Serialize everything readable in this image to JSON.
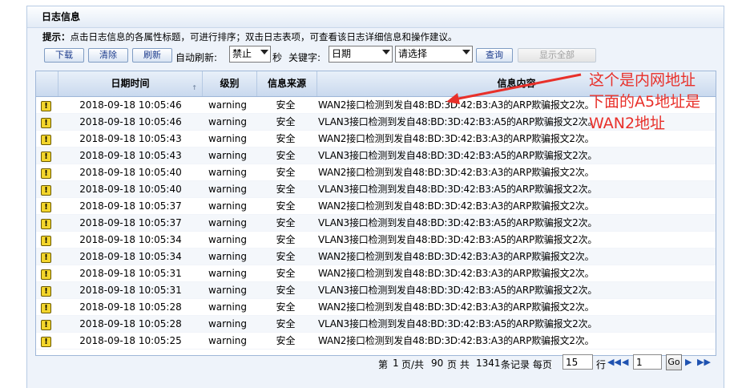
{
  "panel": {
    "title": "日志信息"
  },
  "tip": {
    "label": "提示：",
    "text": "点击日志信息的各属性标题，可进行排序；双击日志表项，可查看该日志详细信息和操作建议。"
  },
  "toolbar": {
    "download_label": "下载",
    "clear_label": "清除",
    "refresh_label": "刷新",
    "auto_refresh_label": "自动刷新:",
    "auto_refresh_value": "禁止",
    "seconds_label": "秒",
    "keyword_label": "关键字:",
    "keyword_field_value": "日期",
    "keyword_select_value": "请选择",
    "query_label": "查询",
    "show_all_label": "显示全部"
  },
  "table": {
    "headers": {
      "date": "日期时间",
      "level": "级别",
      "source": "信息来源",
      "message": "信息内容"
    },
    "rows": [
      {
        "date": "2018-09-18 10:05:46",
        "level": "warning",
        "source": "安全",
        "message": "WAN2接口检测到发自48:BD:3D:42:B3:A3的ARP欺骗报文2次。"
      },
      {
        "date": "2018-09-18 10:05:46",
        "level": "warning",
        "source": "安全",
        "message": "VLAN3接口检测到发自48:BD:3D:42:B3:A5的ARP欺骗报文2次。"
      },
      {
        "date": "2018-09-18 10:05:43",
        "level": "warning",
        "source": "安全",
        "message": "WAN2接口检测到发自48:BD:3D:42:B3:A3的ARP欺骗报文2次。"
      },
      {
        "date": "2018-09-18 10:05:43",
        "level": "warning",
        "source": "安全",
        "message": "VLAN3接口检测到发自48:BD:3D:42:B3:A5的ARP欺骗报文2次。"
      },
      {
        "date": "2018-09-18 10:05:40",
        "level": "warning",
        "source": "安全",
        "message": "WAN2接口检测到发自48:BD:3D:42:B3:A3的ARP欺骗报文2次。"
      },
      {
        "date": "2018-09-18 10:05:40",
        "level": "warning",
        "source": "安全",
        "message": "VLAN3接口检测到发自48:BD:3D:42:B3:A5的ARP欺骗报文2次。"
      },
      {
        "date": "2018-09-18 10:05:37",
        "level": "warning",
        "source": "安全",
        "message": "WAN2接口检测到发自48:BD:3D:42:B3:A3的ARP欺骗报文2次。"
      },
      {
        "date": "2018-09-18 10:05:37",
        "level": "warning",
        "source": "安全",
        "message": "VLAN3接口检测到发自48:BD:3D:42:B3:A5的ARP欺骗报文2次。"
      },
      {
        "date": "2018-09-18 10:05:34",
        "level": "warning",
        "source": "安全",
        "message": "VLAN3接口检测到发自48:BD:3D:42:B3:A5的ARP欺骗报文2次。"
      },
      {
        "date": "2018-09-18 10:05:34",
        "level": "warning",
        "source": "安全",
        "message": "WAN2接口检测到发自48:BD:3D:42:B3:A3的ARP欺骗报文2次。"
      },
      {
        "date": "2018-09-18 10:05:31",
        "level": "warning",
        "source": "安全",
        "message": "WAN2接口检测到发自48:BD:3D:42:B3:A3的ARP欺骗报文2次。"
      },
      {
        "date": "2018-09-18 10:05:31",
        "level": "warning",
        "source": "安全",
        "message": "VLAN3接口检测到发自48:BD:3D:42:B3:A5的ARP欺骗报文2次。"
      },
      {
        "date": "2018-09-18 10:05:28",
        "level": "warning",
        "source": "安全",
        "message": "WAN2接口检测到发自48:BD:3D:42:B3:A3的ARP欺骗报文2次。"
      },
      {
        "date": "2018-09-18 10:05:28",
        "level": "warning",
        "source": "安全",
        "message": "VLAN3接口检测到发自48:BD:3D:42:B3:A5的ARP欺骗报文2次。"
      },
      {
        "date": "2018-09-18 10:05:25",
        "level": "warning",
        "source": "安全",
        "message": "WAN2接口检测到发自48:BD:3D:42:B3:A3的ARP欺骗报文2次。"
      }
    ]
  },
  "pager": {
    "page_label": "第",
    "current_page": "1",
    "total_label": "页/共",
    "total_pages": "90",
    "pages_label": "页 共",
    "total_records": "1341",
    "records_label": "条记录 每页",
    "per_page": "15",
    "rows_label": "行",
    "goto_value": "1",
    "go_label": "Go"
  },
  "annotation": {
    "line1": "这个是内网地址",
    "line2": "下面的A5地址是",
    "line3": "WAN2地址",
    "color": "#e8302a"
  },
  "colors": {
    "warning_icon": "#f3d52b",
    "header_bg": "#c9d9ee",
    "link_blue": "#1f52b0"
  }
}
